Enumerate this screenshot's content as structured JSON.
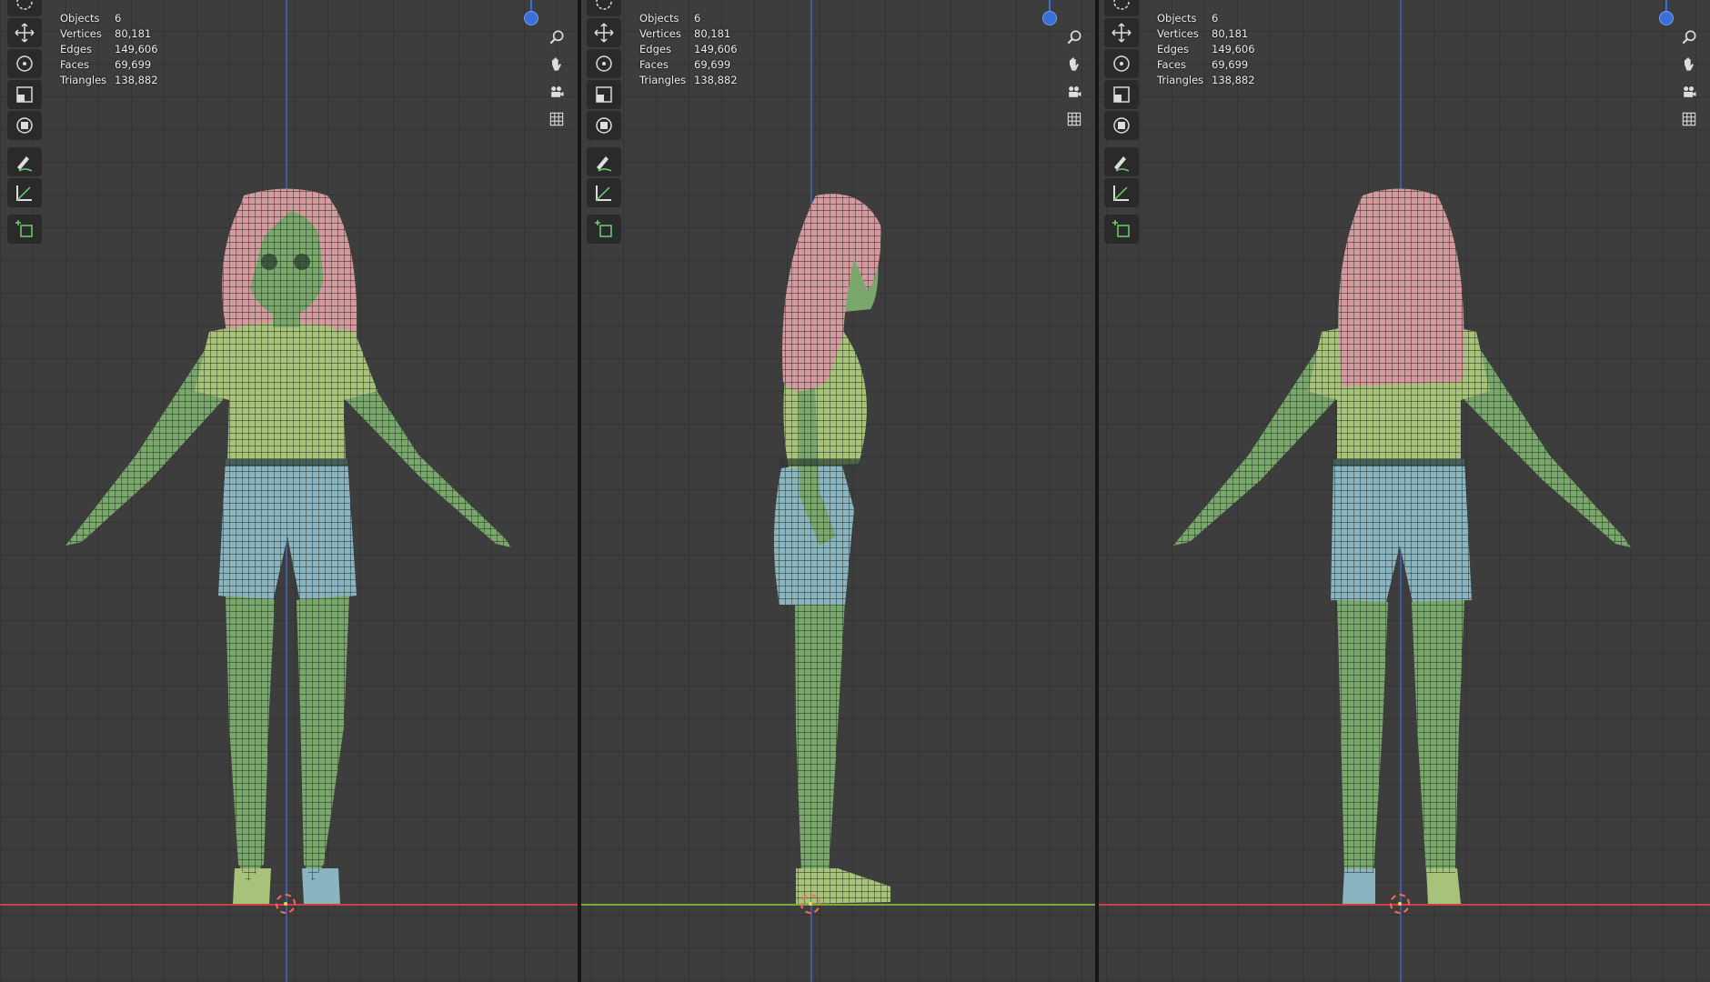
{
  "stats": {
    "labels": [
      "Objects",
      "Vertices",
      "Edges",
      "Faces",
      "Triangles"
    ],
    "values": [
      "6",
      "80,181",
      "149,606",
      "69,699",
      "138,882"
    ]
  },
  "tools": [
    "cursor-icon",
    "move-icon",
    "rotate-icon",
    "scale-icon",
    "transform-icon",
    "annotate-icon",
    "measure-icon",
    "add-cube-icon"
  ],
  "nav_icons": [
    "zoom-icon",
    "pan-icon",
    "camera-icon",
    "grid-icon"
  ],
  "viewports": [
    {
      "view": "front"
    },
    {
      "view": "side"
    },
    {
      "view": "back"
    }
  ],
  "colors": {
    "background": "#3d3d3d",
    "grid": "#333333",
    "skin": "#7aa86c",
    "hair": "#d49aa0",
    "shorts": "#8ab4c0",
    "shirt": "#a9c27a",
    "x_axis": "#c84242",
    "y_axis": "#7ea83a",
    "z_axis": "#3f62b0"
  }
}
